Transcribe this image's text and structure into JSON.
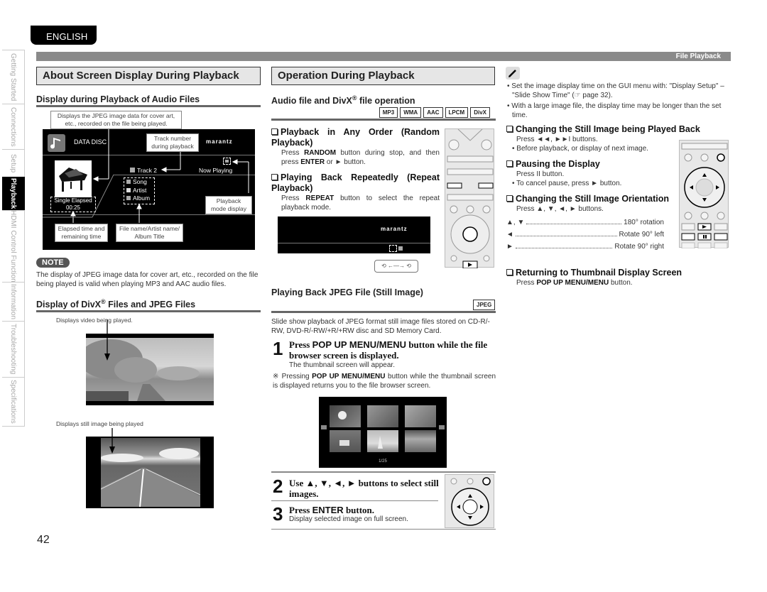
{
  "language_tab": "ENGLISH",
  "side_nav": [
    {
      "label": "Getting Started",
      "active": false
    },
    {
      "label": "Connections",
      "active": false
    },
    {
      "label": "Setup",
      "active": false
    },
    {
      "label": "Playback",
      "active": true
    },
    {
      "label": "HDMI Control Function",
      "active": false
    },
    {
      "label": "Information",
      "active": false
    },
    {
      "label": "Troubleshooting",
      "active": false
    },
    {
      "label": "Specifications",
      "active": false
    }
  ],
  "header": {
    "section": "File Playback"
  },
  "left": {
    "title": "About Screen Display During Playback",
    "audio_sub": "Display during Playback of Audio Files",
    "audio_callout_top": "Displays the JPEG image data for cover art, etc., recorded on the file being played.",
    "screen": {
      "disc_label": "DATA DISC",
      "brand": "marantz",
      "track": "Track 2",
      "now_playing": "Now Playing",
      "song": "Song",
      "artist": "Artist",
      "album": "Album",
      "elapsed_label": "Single Elapsed",
      "elapsed_time": "00:25"
    },
    "callouts": {
      "track_number": "Track number during playback",
      "playback_mode": "Playback mode display",
      "elapsed": "Elapsed time and remaining time",
      "file_name": "File name/Artist name/ Album Title"
    },
    "note_label": "NOTE",
    "note_text": "The display of JPEG image data for cover art, etc., recorded on the file being played is valid when playing MP3 and AAC audio files.",
    "divx_sub_a": "Display of DivX",
    "divx_sub_sup": "®",
    "divx_sub_b": " Files and JPEG Files",
    "video_caption": "Displays video being played.",
    "still_caption": "Displays still image being played"
  },
  "middle": {
    "title": "Operation During Playback",
    "audio_sub_a": "Audio file and DivX",
    "audio_sub_sup": "®",
    "audio_sub_b": " file operation",
    "formats": [
      "MP3",
      "WMA",
      "AAC",
      "LPCM",
      "DivX"
    ],
    "random": {
      "heading": "Playback in Any Order (Random Playback)",
      "text_a": "Press ",
      "bold_a": "RANDOM",
      "text_b": " button during stop, and then press ",
      "bold_b": "ENTER",
      "text_c": " or ► button."
    },
    "repeat": {
      "heading": "Playing Back Repeatedly (Repeat Playback)",
      "text_a": "Press ",
      "bold_a": "REPEAT",
      "text_b": " button to select the repeat playback mode."
    },
    "jpeg_sub": "Playing Back JPEG File (Still Image)",
    "jpeg_badge": "JPEG",
    "jpeg_intro": "Slide show playback of JPEG format still image files stored on CD-R/-RW, DVD-R/-RW/+R/+RW disc and SD Memory Card.",
    "step1": {
      "num": "1",
      "title_a": "Press ",
      "title_bold": "POP UP MENU/MENU",
      "title_b": " button while the file browser screen is displayed.",
      "detail": "The thumbnail screen will appear.",
      "note_a": "※ Pressing ",
      "note_bold": "POP UP MENU/MENU",
      "note_b": " button while the thumbnail screen is displayed returns you to the file browser screen."
    },
    "thumb_counter": "1/25",
    "step2": {
      "num": "2",
      "title": "Use ▲, ▼, ◄, ► buttons to select still images."
    },
    "step3": {
      "num": "3",
      "title_a": "Press ",
      "title_bold": "ENTER",
      "title_b": " button.",
      "detail": "Display selected image on full screen."
    }
  },
  "right": {
    "tips": [
      "Set the image display time on the GUI menu with: \"Display Setup\" – \"Slide Show Time\" (☞ page 32).",
      "With a large image file, the display time may be longer than the set time."
    ],
    "change_image": {
      "heading": "Changing the Still Image being Played Back",
      "text": "Press ◄◄, ►►I buttons.",
      "bullet": "Before playback, or display of next image."
    },
    "pause": {
      "heading": "Pausing the Display",
      "text": "Press II button.",
      "bullet": "To cancel pause, press ► button."
    },
    "orientation": {
      "heading": "Changing the Still Image Orientation",
      "text": "Press ▲, ▼, ◄, ► buttons.",
      "rows": [
        {
          "key": "▲, ▼",
          "value": "180° rotation"
        },
        {
          "key": "◄",
          "value": "Rotate 90° left"
        },
        {
          "key": "►",
          "value": "Rotate 90° right"
        }
      ]
    },
    "return_thumb": {
      "heading": "Returning to Thumbnail Display Screen",
      "text_a": "Press ",
      "bold": "POP UP MENU/MENU",
      "text_b": " button."
    }
  },
  "page_number": "42"
}
